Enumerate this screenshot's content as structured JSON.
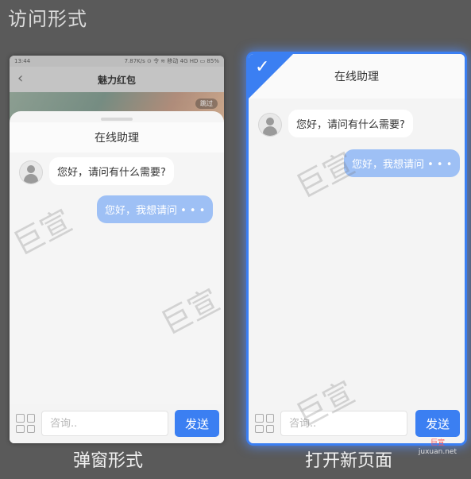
{
  "page": {
    "title": "访问形式"
  },
  "left_phone": {
    "caption": "弹窗形式",
    "status_bar": {
      "time": "13:44",
      "right": "7.87K/s ⊙ 令 ≋ 移动 4G HD ▭ 85%"
    },
    "app_title": "魅力红包",
    "banner_pill": "跳过",
    "sheet_title": "在线助理",
    "incoming_message": "您好，请问有什么需要?",
    "outgoing_message": "您好，我想请问 • • •",
    "input_placeholder": "咨询..",
    "send_label": "发送"
  },
  "right_phone": {
    "caption": "打开新页面",
    "header_title": "在线助理",
    "incoming_message": "您好，请问有什么需要?",
    "outgoing_message": "您好，我想请问 • • •",
    "input_placeholder": "咨询..",
    "send_label": "发送"
  },
  "watermark": {
    "text": "巨宣"
  },
  "site_mark": {
    "brand": "巨宣",
    "url": "juxuan.net"
  },
  "colors": {
    "accent": "#3b7ff2",
    "outgoing_bubble": "#9ec0f5"
  }
}
